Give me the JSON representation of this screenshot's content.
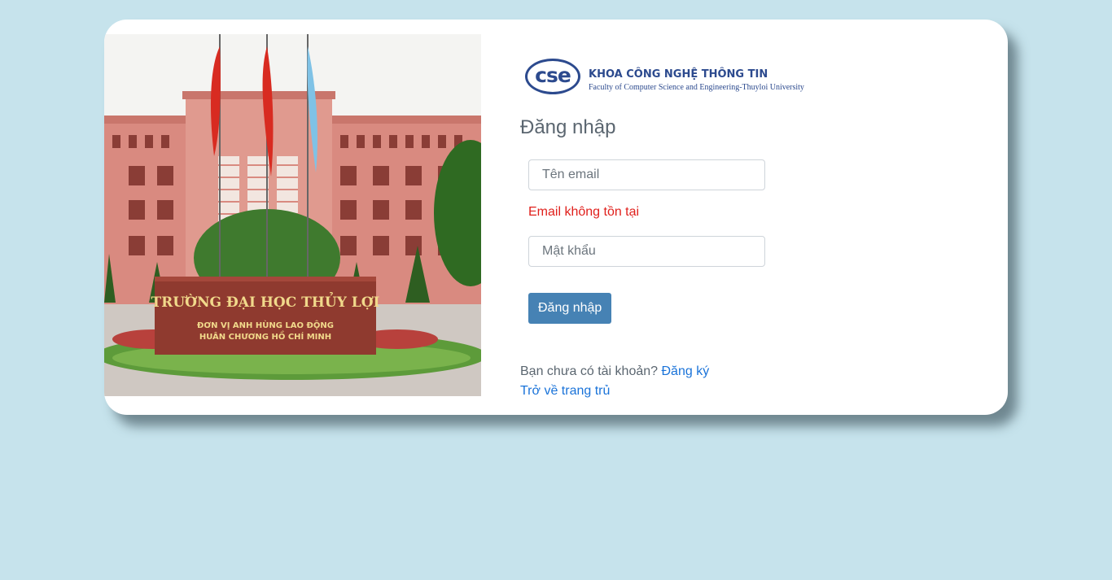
{
  "page": {
    "background": "#c6e3ec"
  },
  "campus_image": {
    "sign_line1": "TRƯỜNG ĐẠI HỌC THỦY LỢI",
    "sign_line2": "ĐƠN VỊ ANH HÙNG LAO ĐỘNG",
    "sign_line3": "HUÂN CHƯƠNG HỒ CHÍ MINH"
  },
  "logo": {
    "mark": "cse",
    "title": "KHOA CÔNG NGHỆ THÔNG TIN",
    "subtitle": "Faculty of Computer Science and Engineering-Thuyloi University",
    "color": "#2c4a8e"
  },
  "login_form": {
    "heading": "Đăng nhập",
    "email_placeholder": "Tên email",
    "email_value": "",
    "error_message": "Email không tồn tại",
    "password_placeholder": "Mật khẩu",
    "password_value": "",
    "submit_label": "Đăng nhập",
    "submit_color": "#4682b4",
    "error_color": "#e0201c"
  },
  "footer_links": {
    "register_prompt": "Bạn chưa có tài khoản?",
    "register_link": "Đăng ký",
    "home_link": "Trở về trang trủ",
    "link_color": "#1a73d9"
  }
}
